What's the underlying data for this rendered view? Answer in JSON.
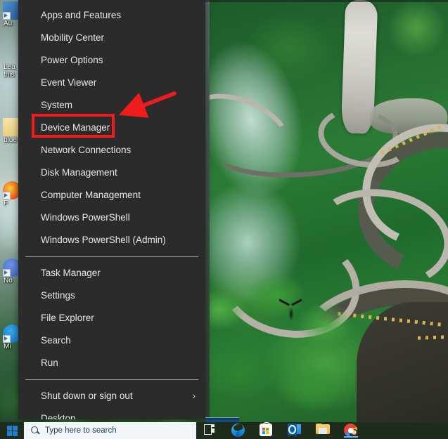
{
  "desktop": {
    "wallpaper_description": "Tianmen Mountain winding road with green forest and mist",
    "icons": [
      {
        "label": "Au",
        "type": "shortcut",
        "color": "#3b6ea5"
      },
      {
        "label": "Lea",
        "label2": "this",
        "type": "text",
        "color": "#d8d8d8"
      },
      {
        "label": "blue",
        "type": "shortcut",
        "color": "#e8c878"
      },
      {
        "label": "F",
        "type": "shortcut",
        "color": "#ef6c2a"
      },
      {
        "label": "No",
        "type": "shortcut",
        "color": "#4d79d6"
      },
      {
        "label": "Mi",
        "type": "shortcut",
        "color": "#1e88d8"
      }
    ]
  },
  "winx_menu": {
    "groups": [
      {
        "items": [
          {
            "label": "Apps and Features",
            "name": "apps-and-features",
            "submenu": false
          },
          {
            "label": "Mobility Center",
            "name": "mobility-center",
            "submenu": false
          },
          {
            "label": "Power Options",
            "name": "power-options",
            "submenu": false
          },
          {
            "label": "Event Viewer",
            "name": "event-viewer",
            "submenu": false
          },
          {
            "label": "System",
            "name": "system",
            "submenu": false
          },
          {
            "label": "Device Manager",
            "name": "device-manager",
            "submenu": false,
            "highlighted": true
          },
          {
            "label": "Network Connections",
            "name": "network-connections",
            "submenu": false
          },
          {
            "label": "Disk Management",
            "name": "disk-management",
            "submenu": false
          },
          {
            "label": "Computer Management",
            "name": "computer-management",
            "submenu": false
          },
          {
            "label": "Windows PowerShell",
            "name": "windows-powershell",
            "submenu": false
          },
          {
            "label": "Windows PowerShell (Admin)",
            "name": "windows-powershell-admin",
            "submenu": false
          }
        ]
      },
      {
        "items": [
          {
            "label": "Task Manager",
            "name": "task-manager",
            "submenu": false
          },
          {
            "label": "Settings",
            "name": "settings",
            "submenu": false
          },
          {
            "label": "File Explorer",
            "name": "file-explorer",
            "submenu": false
          },
          {
            "label": "Search",
            "name": "search",
            "submenu": false
          },
          {
            "label": "Run",
            "name": "run",
            "submenu": false
          }
        ]
      },
      {
        "items": [
          {
            "label": "Shut down or sign out",
            "name": "shut-down-or-sign-out",
            "submenu": true,
            "chevron": "›"
          },
          {
            "label": "Desktop",
            "name": "desktop",
            "submenu": false
          }
        ]
      }
    ]
  },
  "annotation": {
    "highlight_color": "#ee1c1c",
    "highlight_target": "Device Manager",
    "arrow_color": "#ee1c1c"
  },
  "taskbar": {
    "start_button_name": "start-button",
    "search": {
      "placeholder": "Type here to search",
      "value": ""
    },
    "items": [
      {
        "name": "task-view-button",
        "label": "Task View"
      },
      {
        "name": "microsoft-edge-button",
        "label": "Microsoft Edge"
      },
      {
        "name": "microsoft-store-button",
        "label": "Microsoft Store"
      },
      {
        "name": "outlook-button",
        "label": "Outlook"
      },
      {
        "name": "file-explorer-button",
        "label": "File Explorer"
      },
      {
        "name": "google-chrome-button",
        "label": "Google Chrome"
      }
    ]
  }
}
